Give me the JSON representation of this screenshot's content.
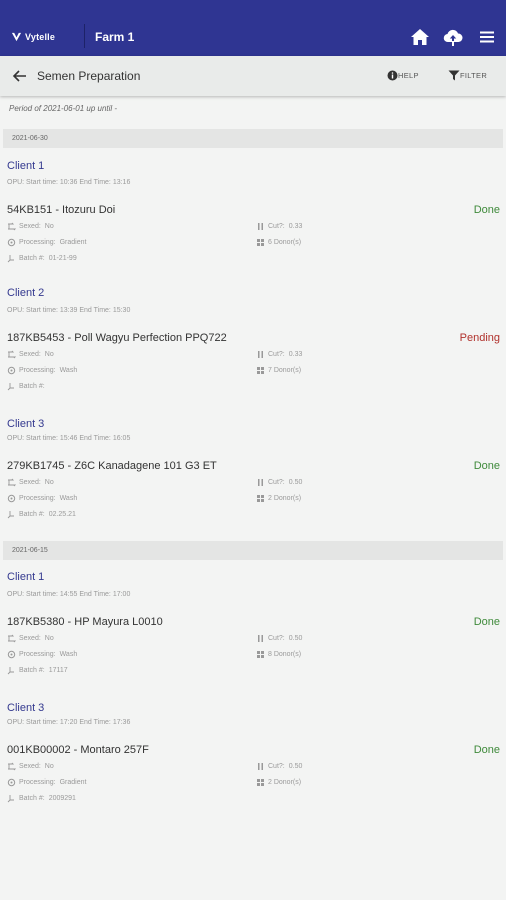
{
  "header": {
    "logo_text": "Vytelle",
    "farm": "Farm 1",
    "icons": [
      "home-icon",
      "cloud-upload-icon",
      "menu-icon"
    ]
  },
  "subheader": {
    "title": "Semen Preparation",
    "help_label": "HELP",
    "filter_label": "FILTER"
  },
  "period": "Period of 2021-06-01 up until -",
  "labels": {
    "sexed": "Sexed:",
    "processing": "Processing:",
    "batch": "Batch #:",
    "cut": "Cut?:",
    "status_done": "Done",
    "status_pending": "Pending"
  },
  "groups": [
    {
      "date": "2021-06-30",
      "entries": [
        {
          "client": "Client 1",
          "opu": "OPU: Start time: 10:36 End Time: 13:16",
          "bull": "54KB151 - Itozuru Doi",
          "status": "Done",
          "sexed": "No",
          "processing": "Gradient",
          "batch": "01-21-99",
          "cut": "0.33",
          "donors": "6 Donor(s)"
        },
        {
          "client": "Client 2",
          "opu": "OPU: Start time: 13:39 End Time: 15:30",
          "bull": "187KB5453 - Poll Wagyu Perfection PPQ722",
          "status": "Pending",
          "sexed": "No",
          "processing": "Wash",
          "batch": "",
          "cut": "0.33",
          "donors": "7 Donor(s)"
        },
        {
          "client": "Client 3",
          "opu": "OPU: Start time: 15:46 End Time: 16:05",
          "bull": "279KB1745 - Z6C Kanadagene 101 G3 ET",
          "status": "Done",
          "sexed": "No",
          "processing": "Wash",
          "batch": "02.25.21",
          "cut": "0.50",
          "donors": "2 Donor(s)"
        }
      ]
    },
    {
      "date": "2021-06-15",
      "entries": [
        {
          "client": "Client 1",
          "opu": "OPU: Start time: 14:55 End Time: 17:00",
          "bull": "187KB5380 - HP Mayura L0010",
          "status": "Done",
          "sexed": "No",
          "processing": "Wash",
          "batch": "17117",
          "cut": "0.50",
          "donors": "8 Donor(s)"
        },
        {
          "client": "Client 3",
          "opu": "OPU: Start time: 17:20 End Time: 17:36",
          "bull": "001KB00002 - Montaro 257F",
          "status": "Done",
          "sexed": "No",
          "processing": "Gradient",
          "batch": "2009291",
          "cut": "0.50",
          "donors": "2 Donor(s)"
        }
      ]
    }
  ]
}
